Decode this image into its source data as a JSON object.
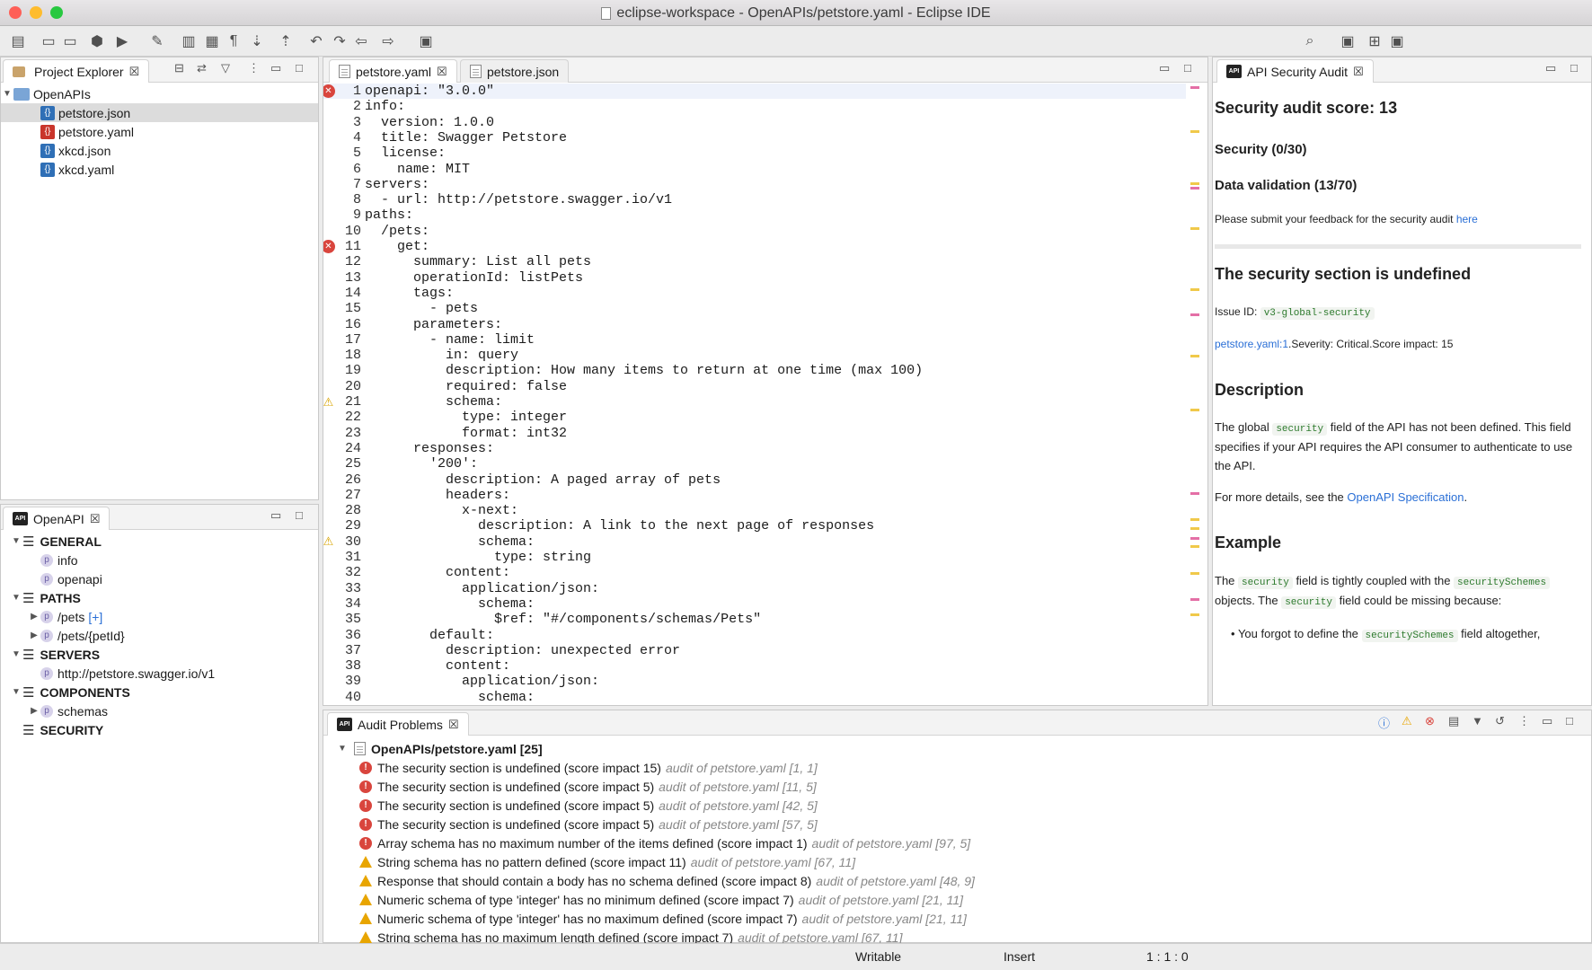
{
  "window": {
    "title": "eclipse-workspace - OpenAPIs/petstore.yaml - Eclipse IDE"
  },
  "colors": {
    "close": "#fe5f57",
    "minimize": "#febc2e",
    "maximize": "#28c840",
    "error": "#d9453d",
    "warning": "#e8a500",
    "link": "#2a6fd6",
    "accent": "#2f6fb6"
  },
  "toolbar_icons": [
    "new-icon",
    "save-icon",
    "save-all-icon",
    "openapi-icon",
    "run-icon",
    "tools-icon",
    "open-type-icon",
    "open-task-icon",
    "show-whitespace-icon",
    "next-annotation-icon",
    "prev-annotation-icon",
    "back-edit-icon",
    "forward-edit-icon",
    "back-icon",
    "forward-icon",
    "pin-icon",
    "search-icon",
    "perspective-icon",
    "openapi-perspective-icon",
    "api-perspective-icon"
  ],
  "project_explorer": {
    "tab_label": "Project Explorer",
    "root": "OpenAPIs",
    "files": [
      {
        "name": "petstore.json",
        "selected": true,
        "has_error": false
      },
      {
        "name": "petstore.yaml",
        "selected": false,
        "has_error": true
      },
      {
        "name": "xkcd.json",
        "selected": false,
        "has_error": false
      },
      {
        "name": "xkcd.yaml",
        "selected": false,
        "has_error": false
      }
    ]
  },
  "outline": {
    "tab_label": "OpenAPI",
    "sections": [
      {
        "label": "GENERAL",
        "children": [
          {
            "label": "info"
          },
          {
            "label": "openapi"
          }
        ]
      },
      {
        "label": "PATHS",
        "children": [
          {
            "label": "/pets",
            "badge": "[+]"
          },
          {
            "label": "/pets/{petId}"
          }
        ]
      },
      {
        "label": "SERVERS",
        "children": [
          {
            "label": "http://petstore.swagger.io/v1"
          }
        ]
      },
      {
        "label": "COMPONENTS",
        "children": [
          {
            "label": "schemas"
          }
        ]
      },
      {
        "label": "SECURITY",
        "children": []
      }
    ]
  },
  "editor": {
    "tabs": [
      {
        "label": "petstore.yaml",
        "active": true
      },
      {
        "label": "petstore.json",
        "active": false
      }
    ],
    "lines": [
      {
        "n": "1",
        "t": "openapi: \"3.0.0\"",
        "m": "error"
      },
      {
        "n": "2",
        "t": "info:"
      },
      {
        "n": "3",
        "t": "  version: 1.0.0"
      },
      {
        "n": "4",
        "t": "  title: Swagger Petstore"
      },
      {
        "n": "5",
        "t": "  license:"
      },
      {
        "n": "6",
        "t": "    name: MIT"
      },
      {
        "n": "7",
        "t": "servers:"
      },
      {
        "n": "8",
        "t": "  - url: http://petstore.swagger.io/v1"
      },
      {
        "n": "9",
        "t": "paths:"
      },
      {
        "n": "10",
        "t": "  /pets:"
      },
      {
        "n": "11",
        "t": "    get:",
        "m": "error"
      },
      {
        "n": "12",
        "t": "      summary: List all pets"
      },
      {
        "n": "13",
        "t": "      operationId: listPets"
      },
      {
        "n": "14",
        "t": "      tags:"
      },
      {
        "n": "15",
        "t": "        - pets"
      },
      {
        "n": "16",
        "t": "      parameters:"
      },
      {
        "n": "17",
        "t": "        - name: limit"
      },
      {
        "n": "18",
        "t": "          in: query"
      },
      {
        "n": "19",
        "t": "          description: How many items to return at one time (max 100)"
      },
      {
        "n": "20",
        "t": "          required: false"
      },
      {
        "n": "21",
        "t": "          schema:",
        "m": "warning"
      },
      {
        "n": "22",
        "t": "            type: integer"
      },
      {
        "n": "23",
        "t": "            format: int32"
      },
      {
        "n": "24",
        "t": "      responses:"
      },
      {
        "n": "25",
        "t": "        '200':"
      },
      {
        "n": "26",
        "t": "          description: A paged array of pets"
      },
      {
        "n": "27",
        "t": "          headers:"
      },
      {
        "n": "28",
        "t": "            x-next:"
      },
      {
        "n": "29",
        "t": "              description: A link to the next page of responses"
      },
      {
        "n": "30",
        "t": "              schema:",
        "m": "warning"
      },
      {
        "n": "31",
        "t": "                type: string"
      },
      {
        "n": "32",
        "t": "          content:"
      },
      {
        "n": "33",
        "t": "            application/json:"
      },
      {
        "n": "34",
        "t": "              schema:"
      },
      {
        "n": "35",
        "t": "                $ref: \"#/components/schemas/Pets\""
      },
      {
        "n": "36",
        "t": "        default:"
      },
      {
        "n": "37",
        "t": "          description: unexpected error"
      },
      {
        "n": "38",
        "t": "          content:"
      },
      {
        "n": "39",
        "t": "            application/json:"
      },
      {
        "n": "40",
        "t": "              schema:"
      }
    ]
  },
  "audit": {
    "tab_label": "API Security Audit",
    "score_title": "Security audit score: 13",
    "security": "Security (0/30)",
    "data_validation": "Data validation (13/70)",
    "feedback_text": "Please submit your feedback for the security audit ",
    "feedback_link": "here",
    "issue_title": "The security section is undefined",
    "issue_id_label": "Issue ID:",
    "issue_id": "v3-global-security",
    "location_link": "petstore.yaml:1",
    "location_rest": ".Severity: Critical.Score impact: 15",
    "description_heading": "Description",
    "desc_1": "The global ",
    "desc_code": "security",
    "desc_2": " field of the API has not been defined. This field specifies if your API requires the API consumer to authenticate to use the API.",
    "more_details": "For more details, see the ",
    "spec_link": "OpenAPI Specification",
    "period": ".",
    "example_heading": "Example",
    "ex_1": "The ",
    "ex_code1": "security",
    "ex_2": " field is tightly coupled with the ",
    "ex_code2": "securitySchemes",
    "ex_3": " objects. The ",
    "ex_code3": "security",
    "ex_4": " field could be missing because:",
    "bullet_1": "You forgot to define the ",
    "bullet_code": "securitySchemes",
    "bullet_2": " field altogether,"
  },
  "problems": {
    "tab_label": "Audit Problems",
    "group": "OpenAPIs/petstore.yaml [25]",
    "items": [
      {
        "severity": "error",
        "text": "The security section is undefined (score impact 15)",
        "location": "audit of petstore.yaml [1, 1]"
      },
      {
        "severity": "error",
        "text": "The security section is undefined (score impact 5)",
        "location": "audit of petstore.yaml [11, 5]"
      },
      {
        "severity": "error",
        "text": "The security section is undefined (score impact 5)",
        "location": "audit of petstore.yaml [42, 5]"
      },
      {
        "severity": "error",
        "text": "The security section is undefined (score impact 5)",
        "location": "audit of petstore.yaml [57, 5]"
      },
      {
        "severity": "error",
        "text": "Array schema has no maximum number of the items defined (score impact 1)",
        "location": "audit of petstore.yaml [97, 5]"
      },
      {
        "severity": "warning",
        "text": "String schema has no pattern defined (score impact 11)",
        "location": "audit of petstore.yaml [67, 11]"
      },
      {
        "severity": "warning",
        "text": "Response that should contain a body has no schema defined (score impact 8)",
        "location": "audit of petstore.yaml [48, 9]"
      },
      {
        "severity": "warning",
        "text": "Numeric schema of type 'integer' has no minimum defined (score impact 7)",
        "location": "audit of petstore.yaml [21, 11]"
      },
      {
        "severity": "warning",
        "text": "Numeric schema of type 'integer' has no maximum defined (score impact 7)",
        "location": "audit of petstore.yaml [21, 11]"
      },
      {
        "severity": "warning",
        "text": "String schema has no maximum length defined (score impact 7)",
        "location": "audit of petstore.yaml [67, 11]"
      }
    ]
  },
  "status": {
    "writable": "Writable",
    "insert": "Insert",
    "position": "1 : 1 : 0"
  }
}
